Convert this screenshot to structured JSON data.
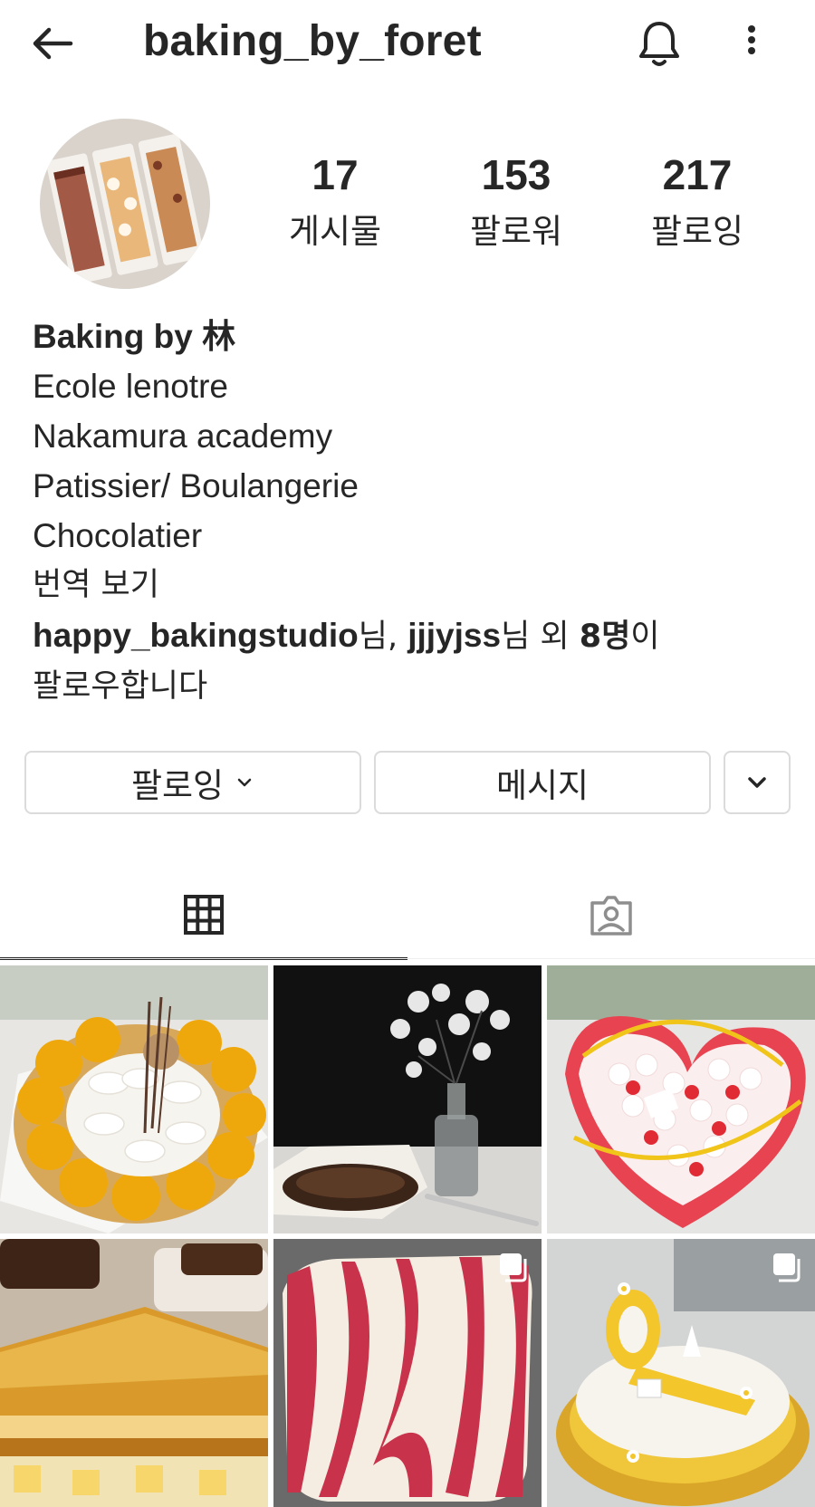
{
  "header": {
    "username": "baking_by_foret",
    "back_icon": "arrow-left-icon",
    "bell_icon": "bell-icon",
    "more_icon": "more-vertical-icon"
  },
  "profile": {
    "stats": [
      {
        "value": "17",
        "label": "게시물"
      },
      {
        "value": "153",
        "label": "팔로워"
      },
      {
        "value": "217",
        "label": "팔로잉"
      }
    ],
    "bio": {
      "name": "Baking by 林",
      "lines": [
        "Ecole lenotre",
        "Nakamura academy",
        "Patissier/ Boulangerie",
        "Chocolatier"
      ],
      "translate": "번역 보기",
      "followed_by": {
        "user1": "happy_bakingstudio",
        "sep1": "님, ",
        "user2": "jjjyjss",
        "sep2": "님 외 ",
        "count": "8명",
        "suffix": "이",
        "line2": "팔로우합니다"
      }
    }
  },
  "actions": {
    "follow_label": "팔로잉",
    "message_label": "메시지"
  },
  "tabs": [
    {
      "name": "grid",
      "icon": "grid-icon",
      "active": true
    },
    {
      "name": "tagged",
      "icon": "tagged-person-icon",
      "active": false
    }
  ],
  "posts": [
    {
      "subject": "mango cream tart",
      "multi": false
    },
    {
      "subject": "basque cheesecake with cherry blossoms",
      "multi": false
    },
    {
      "subject": "heart strawberry macaron cake",
      "multi": false
    },
    {
      "subject": "mille-feuille",
      "multi": false
    },
    {
      "subject": "red patterned roll cake",
      "multi": true
    },
    {
      "subject": "yellow entremet with daisies",
      "multi": true
    }
  ],
  "colors": {
    "text": "#262626",
    "border": "#dbdbdb",
    "icon_gray": "#8e8e8e"
  }
}
